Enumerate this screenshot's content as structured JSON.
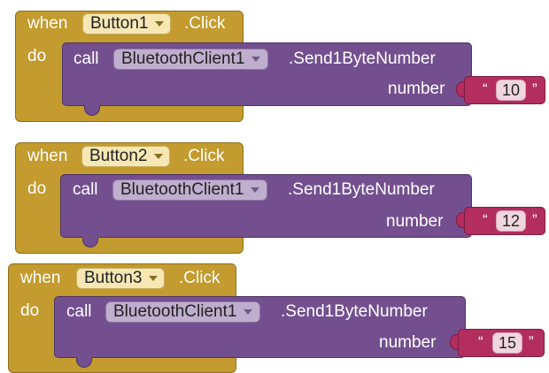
{
  "blocks": [
    {
      "when_label": "when",
      "component": "Button1",
      "event": ".Click",
      "do_label": "do",
      "call": {
        "call_label": "call",
        "component": "BluetoothClient1",
        "method": ".Send1ByteNumber",
        "param_label": "number",
        "value": "10"
      }
    },
    {
      "when_label": "when",
      "component": "Button2",
      "event": ".Click",
      "do_label": "do",
      "call": {
        "call_label": "call",
        "component": "BluetoothClient1",
        "method": ".Send1ByteNumber",
        "param_label": "number",
        "value": "12"
      }
    },
    {
      "when_label": "when",
      "component": "Button3",
      "event": ".Click",
      "do_label": "do",
      "call": {
        "call_label": "call",
        "component": "BluetoothClient1",
        "method": ".Send1ByteNumber",
        "param_label": "number",
        "value": "15"
      }
    }
  ],
  "text_quotes": {
    "open": "“",
    "close": "”"
  },
  "colors": {
    "event_block": "#c39b2e",
    "call_block": "#734f8f",
    "text_block": "#b32d5e"
  }
}
